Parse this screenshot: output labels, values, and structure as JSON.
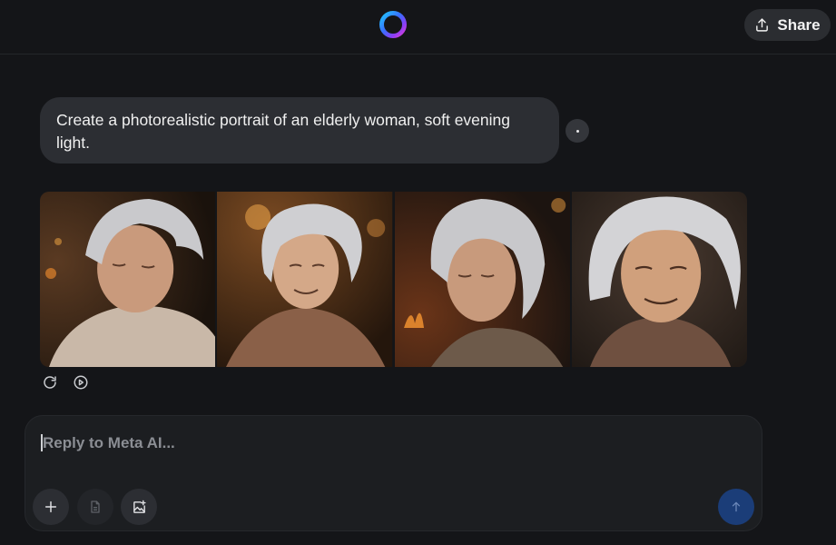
{
  "header": {
    "share_label": "Share",
    "icons": {
      "logo": "meta-ai-ring-logo",
      "share": "upload-share-icon"
    }
  },
  "conversation": {
    "user_prompt": "Create a photorealistic portrait of an elderly woman, soft evening light.",
    "more_icon": "ellipsis-icon",
    "generated_images": [
      {
        "subject": "elderly-woman-eyes-closed-knitting"
      },
      {
        "subject": "elderly-woman-smiling-armchair"
      },
      {
        "subject": "elderly-woman-profile-fireplace"
      },
      {
        "subject": "elderly-woman-closeup-smile"
      }
    ],
    "image_actions": [
      "regenerate-icon",
      "animate-play-icon"
    ]
  },
  "composer": {
    "placeholder": "Reply to Meta AI...",
    "value": "",
    "buttons": [
      "plus-icon",
      "document-icon",
      "add-image-icon",
      "send-arrow-icon"
    ]
  },
  "colors": {
    "background": "#141518",
    "bubble": "#2c2e33",
    "send_button": "#1b3d78",
    "logo_gradient": [
      "#1fa2ff",
      "#6a3df5",
      "#e03fd8"
    ]
  }
}
